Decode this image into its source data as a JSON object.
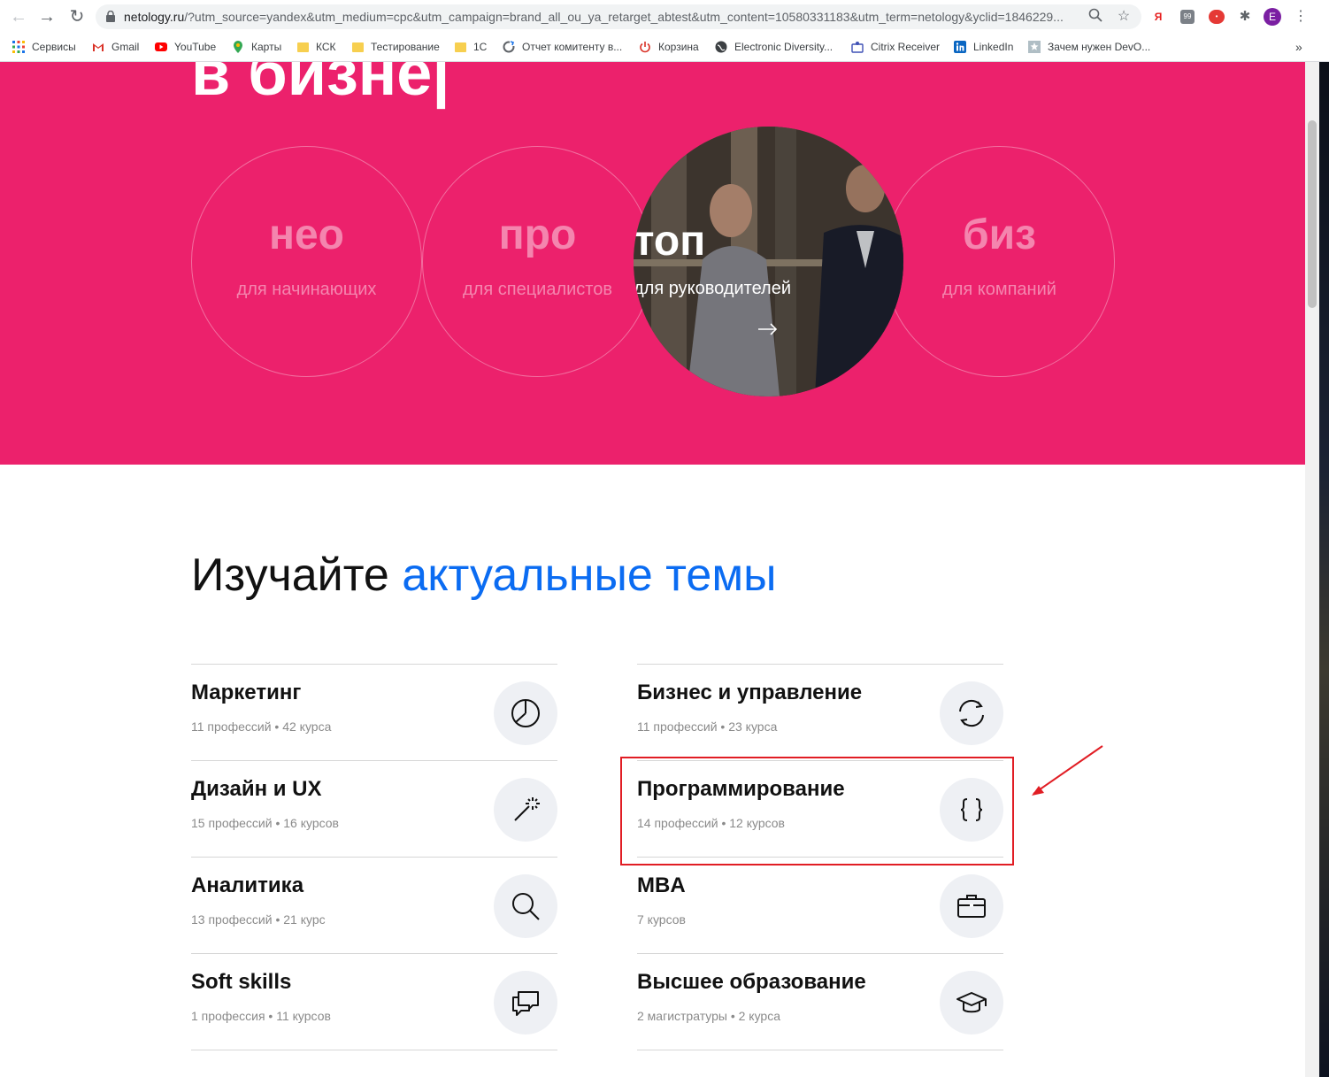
{
  "browser": {
    "url_domain": "netology.ru",
    "url_rest": "/?utm_source=yandex&utm_medium=cpc&utm_campaign=brand_all_ou_ya_retarget_abtest&utm_content=10580331183&utm_term=netology&yclid=1846229...",
    "profile_initial": "E",
    "ext_ya": "Я",
    "ext_badge": "99"
  },
  "bookmarks": [
    {
      "label": "Сервисы",
      "icon": "apps-grid-icon"
    },
    {
      "label": "Gmail",
      "icon": "gmail-icon"
    },
    {
      "label": "YouTube",
      "icon": "youtube-icon"
    },
    {
      "label": "Карты",
      "icon": "maps-pin-icon"
    },
    {
      "label": "КСК",
      "icon": "folder-icon"
    },
    {
      "label": "Тестирование",
      "icon": "folder-icon"
    },
    {
      "label": "1С",
      "icon": "folder-icon"
    },
    {
      "label": "Отчет комитенту в...",
      "icon": "refresh-circle-icon"
    },
    {
      "label": "Корзина",
      "icon": "power-icon"
    },
    {
      "label": "Electronic Diversity...",
      "icon": "globe-icon"
    },
    {
      "label": "Citrix Receiver",
      "icon": "citrix-icon"
    },
    {
      "label": "LinkedIn",
      "icon": "linkedin-icon"
    },
    {
      "label": "Зачем нужен DevO...",
      "icon": "star-badge-icon"
    }
  ],
  "hero": {
    "title": "в бизне|",
    "levels": [
      {
        "word": "нео",
        "sub": "для начинающих"
      },
      {
        "word": "про",
        "sub": "для специалистов"
      },
      {
        "word": "топ",
        "sub": "для руководителей"
      },
      {
        "word": "биз",
        "sub": "для компаний"
      }
    ],
    "colors": {
      "background": "#ec216c",
      "accent": "#0b6cf2",
      "highlight": "#e11d24"
    }
  },
  "section": {
    "title_plain": "Изучайте ",
    "title_accent": "актуальные темы"
  },
  "topics": [
    {
      "title": "Маркетинг",
      "meta": "11 профессий • 42 курса",
      "icon": "pie-chart-icon"
    },
    {
      "title": "Бизнес и управление",
      "meta": "11 профессий • 23 курса",
      "icon": "cycle-arrows-icon"
    },
    {
      "title": "Дизайн и UX",
      "meta": "15 профессий • 16 курсов",
      "icon": "magic-wand-icon"
    },
    {
      "title": "Программирование",
      "meta": "14 профессий • 12 курсов",
      "icon": "code-braces-icon"
    },
    {
      "title": "Аналитика",
      "meta": "13 профессий • 21 курс",
      "icon": "search-icon"
    },
    {
      "title": "MBA",
      "meta": "7 курсов",
      "icon": "briefcase-icon"
    },
    {
      "title": "Soft skills",
      "meta": "1 профессия • 11 курсов",
      "icon": "chat-bubbles-icon"
    },
    {
      "title": "Высшее образование",
      "meta": "2 магистратуры • 2 курса",
      "icon": "graduation-cap-icon"
    }
  ]
}
